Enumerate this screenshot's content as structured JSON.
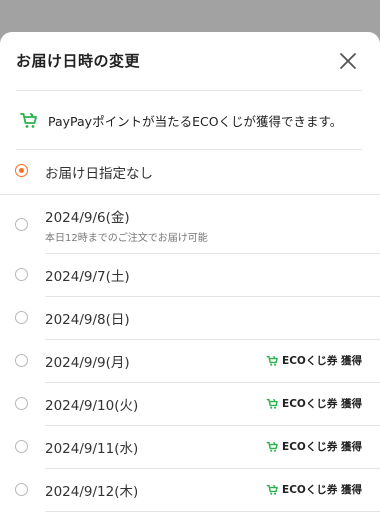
{
  "modal": {
    "title": "お届け日時の変更",
    "close_icon": "close-icon"
  },
  "banner": {
    "icon": "cart-icon",
    "text": "PayPayポイントが当たるECOくじが獲得できます。"
  },
  "options": [
    {
      "label": "お届け日指定なし",
      "selected": true
    },
    {
      "label": "2024/9/6(金)",
      "sublabel": "本日12時までのご注文でお届け可能",
      "selected": false
    },
    {
      "label": "2024/9/7(土)",
      "selected": false
    },
    {
      "label": "2024/9/8(日)",
      "selected": false
    },
    {
      "label": "2024/9/9(月)",
      "badge": "ECOくじ券 獲得",
      "selected": false
    },
    {
      "label": "2024/9/10(火)",
      "badge": "ECOくじ券 獲得",
      "selected": false
    },
    {
      "label": "2024/9/11(水)",
      "badge": "ECOくじ券 獲得",
      "selected": false
    },
    {
      "label": "2024/9/12(木)",
      "badge": "ECOくじ券 獲得",
      "selected": false
    }
  ],
  "colors": {
    "accent_orange": "#ff6d1f",
    "eco_green": "#2bb24c"
  }
}
